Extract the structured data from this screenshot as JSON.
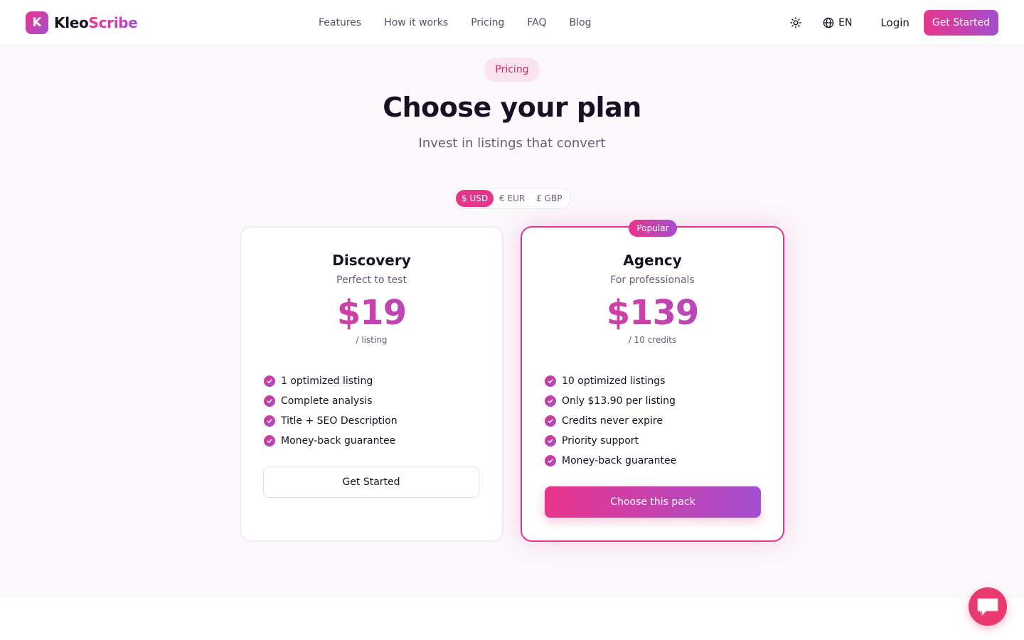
{
  "brand": {
    "mark": "K",
    "name_a": "Kleo",
    "name_b": "Scribe"
  },
  "nav": [
    "Features",
    "How it works",
    "Pricing",
    "FAQ",
    "Blog"
  ],
  "header": {
    "lang": "EN",
    "login": "Login",
    "cta": "Get Started",
    "theme_icon": "sun-icon",
    "lang_icon": "globe-icon"
  },
  "section": {
    "pill": "Pricing",
    "title": "Choose your plan",
    "subtitle": "Invest in listings that convert"
  },
  "currency": {
    "options": [
      "$ USD",
      "€ EUR",
      "£ GBP"
    ],
    "selected": "$ USD"
  },
  "plans": [
    {
      "name": "Discovery",
      "desc": "Perfect to test",
      "price": "$19",
      "unit": "/ listing",
      "features": [
        "1 optimized listing",
        "Complete analysis",
        "Title + SEO Description",
        "Money-back guarantee"
      ],
      "button": "Get Started"
    },
    {
      "badge": "Popular",
      "name": "Agency",
      "desc": "For professionals",
      "price": "$139",
      "unit": "/ 10 credits",
      "features": [
        "10 optimized listings",
        "Only $13.90 per listing",
        "Credits never expire",
        "Priority support",
        "Money-back guarantee"
      ],
      "button": "Choose this pack"
    }
  ],
  "colors": {
    "accent": "#e8358c",
    "accent2": "#a44fd0",
    "chat": "#e83a6e"
  },
  "chat": {
    "icon": "chat-bubble-icon"
  }
}
